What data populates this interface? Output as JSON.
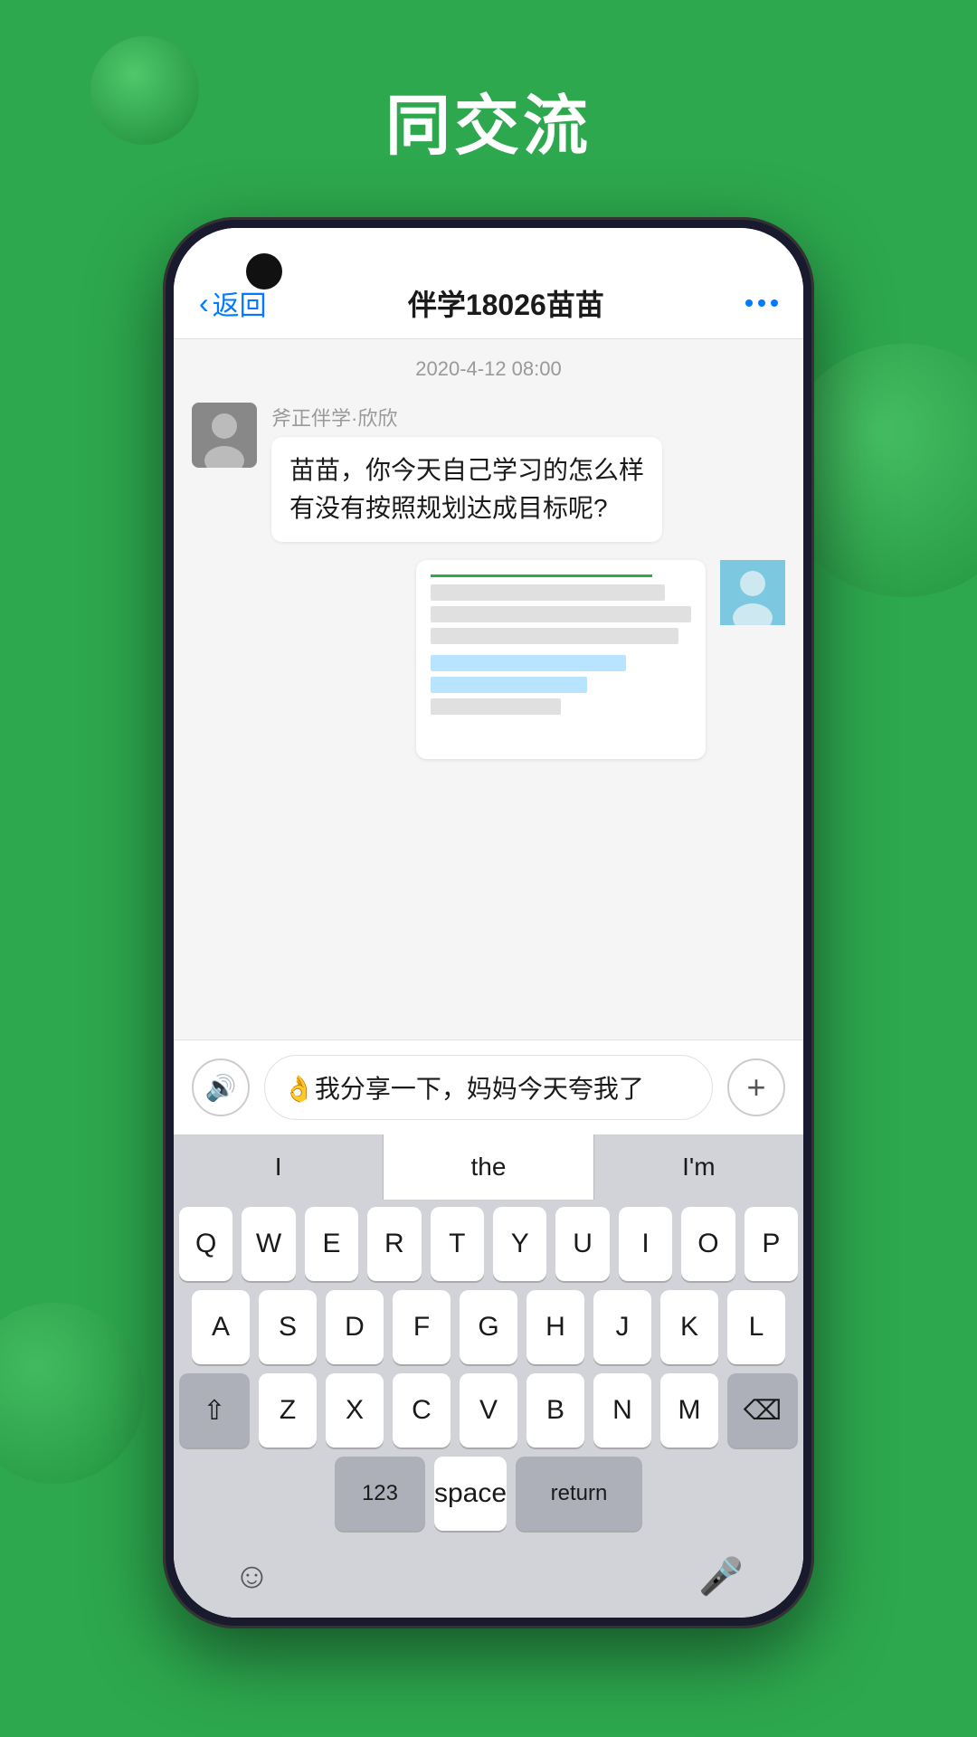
{
  "page": {
    "title": "同交流",
    "background_color": "#2da84e"
  },
  "header": {
    "back_label": "返回",
    "chat_title": "伴学18026苗苗",
    "more_dots": "···"
  },
  "chat": {
    "timestamp": "2020-4-12  08:00",
    "sender_name": "斧正伴学·欣欣",
    "message_text": "苗苗，你今天自己学习的怎么样\n有没有按照规划达成目标呢?",
    "input_text": "👌我分享一下，妈妈今天夸我了"
  },
  "keyboard": {
    "suggestions": [
      "I",
      "the",
      "I'm"
    ],
    "rows": [
      [
        "Q",
        "W",
        "E",
        "R",
        "T",
        "Y",
        "U",
        "I",
        "O",
        "P"
      ],
      [
        "A",
        "S",
        "D",
        "F",
        "G",
        "H",
        "J",
        "K",
        "L"
      ],
      [
        "Z",
        "X",
        "C",
        "V",
        "B",
        "N",
        "M"
      ],
      [
        "123",
        "space",
        "return"
      ]
    ],
    "space_label": "space",
    "return_label": "return",
    "nums_label": "123"
  }
}
